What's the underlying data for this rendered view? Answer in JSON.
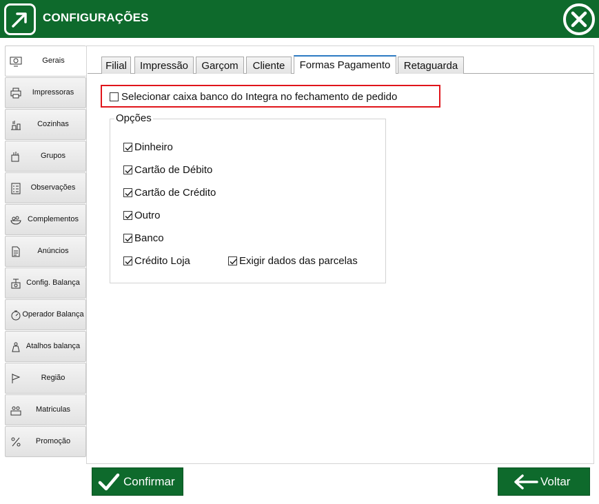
{
  "header": {
    "title": "CONFIGURAÇÕES",
    "logo_icon": "integra-logo-icon",
    "close_icon": "close-icon",
    "bar_color": "#0e6a2c"
  },
  "sidebar": {
    "items": [
      {
        "label": "Gerais",
        "icon": "settings-monitor-icon",
        "active": true
      },
      {
        "label": "Impressoras",
        "icon": "printer-icon"
      },
      {
        "label": "Cozinhas",
        "icon": "kitchen-icon"
      },
      {
        "label": "Grupos",
        "icon": "groups-icon"
      },
      {
        "label": "Observações",
        "icon": "checklist-icon"
      },
      {
        "label": "Complementos",
        "icon": "complements-icon"
      },
      {
        "label": "Anúncios",
        "icon": "document-icon"
      },
      {
        "label": "Config. Balança",
        "icon": "scale-icon"
      },
      {
        "label": "Operador  Balança",
        "icon": "scale-dial-icon"
      },
      {
        "label": "Atalhos balança",
        "icon": "scale-weight-icon"
      },
      {
        "label": "Região",
        "icon": "flag-icon"
      },
      {
        "label": "Matriculas",
        "icon": "registration-icon"
      },
      {
        "label": "Promoção",
        "icon": "promotion-icon"
      }
    ]
  },
  "tabs": [
    {
      "label": "Filial"
    },
    {
      "label": "Impressão"
    },
    {
      "label": "Garçom"
    },
    {
      "label": "Cliente"
    },
    {
      "label": "Formas Pagamento",
      "active": true
    },
    {
      "label": "Retaguarda"
    }
  ],
  "settings": {
    "select_bank_checkbox": {
      "label": "Selecionar caixa banco do Integra no fechamento de pedido",
      "checked": false
    },
    "options_group": {
      "title": "Opções",
      "items": [
        {
          "label": "Dinheiro",
          "checked": true
        },
        {
          "label": "Cartão de Débito",
          "checked": true
        },
        {
          "label": "Cartão de Crédito",
          "checked": true
        },
        {
          "label": "Outro",
          "checked": true
        },
        {
          "label": "Banco",
          "checked": true
        },
        {
          "label": "Crédito Loja",
          "checked": true
        }
      ],
      "installment_details": {
        "label": "Exigir dados das parcelas",
        "checked": true
      }
    }
  },
  "footer": {
    "confirm_label": "Confirmar",
    "back_label": "Voltar",
    "button_color": "#0e6a2c"
  }
}
